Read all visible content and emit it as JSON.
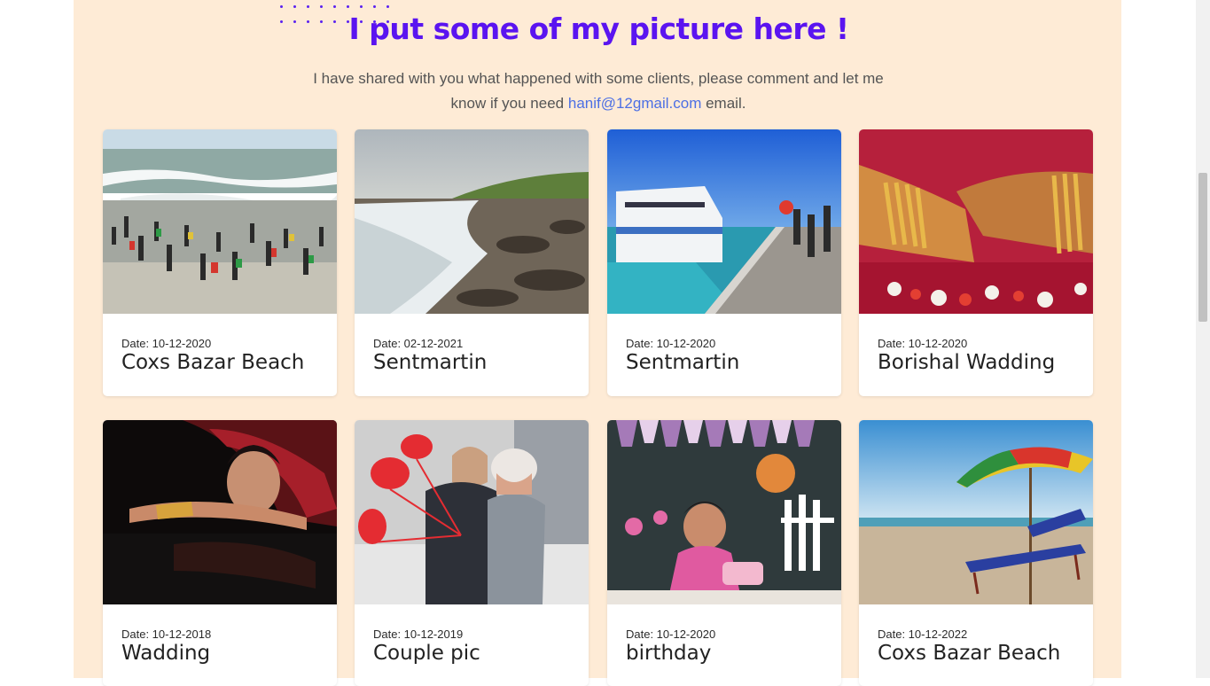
{
  "section": {
    "title": "I put some of my picture here !",
    "intro_before": "I have shared with you what happened with some clients, please comment and let me know if you need",
    "email_link": "hanif@12gmail.com",
    "intro_after": "email."
  },
  "cards": [
    {
      "date": "Date: 10-12-2020",
      "title": "Coxs Bazar Beach",
      "photo": "crowded beach"
    },
    {
      "date": "Date: 02-12-2021",
      "title": "Sentmartin",
      "photo": "rocky shore"
    },
    {
      "date": "Date: 10-12-2020",
      "title": "Sentmartin",
      "photo": "ferry at jetty"
    },
    {
      "date": "Date: 10-12-2020",
      "title": "Borishal Wadding",
      "photo": "wedding hands"
    },
    {
      "date": "Date: 10-12-2018",
      "title": "Wadding",
      "photo": "bride portrait"
    },
    {
      "date": "Date: 10-12-2019",
      "title": "Couple pic",
      "photo": "couple with balloons"
    },
    {
      "date": "Date: 10-12-2020",
      "title": "birthday",
      "photo": "baby birthday"
    },
    {
      "date": "Date: 10-12-2022",
      "title": "Coxs Bazar Beach",
      "photo": "beach umbrellas"
    }
  ],
  "colors": {
    "panel_bg": "#feebd6",
    "heading": "#5a14f0",
    "link": "#4c6fe4"
  }
}
